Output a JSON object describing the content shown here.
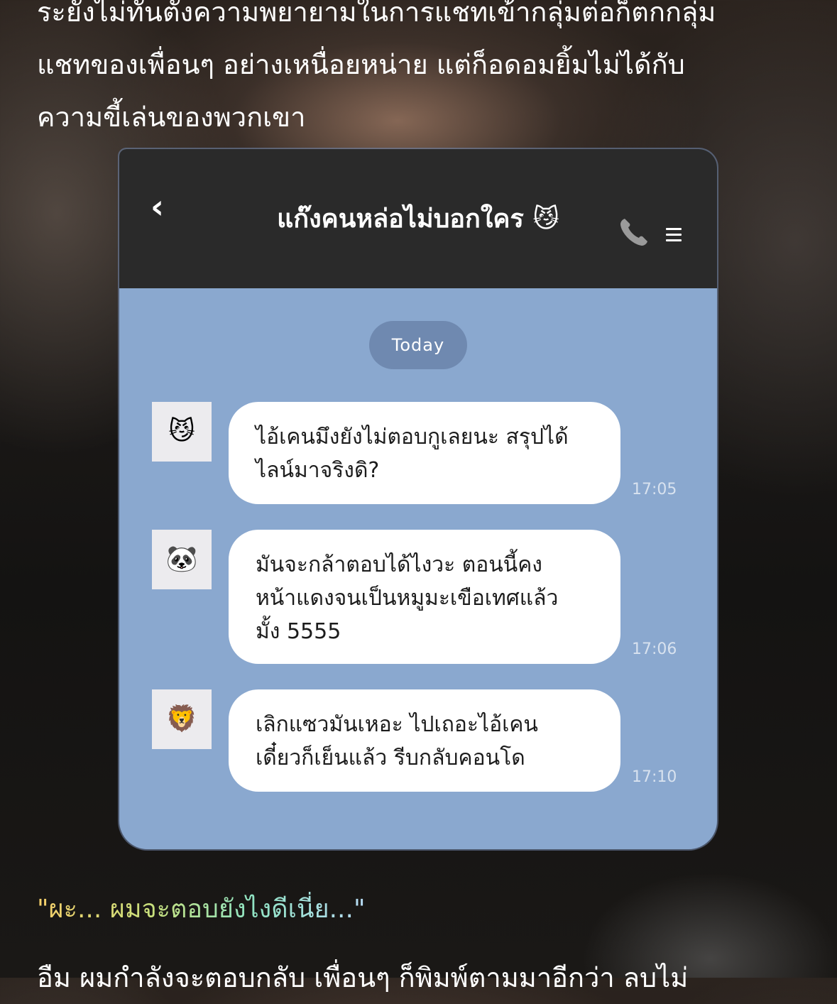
{
  "narration": {
    "top_lines": [
      "ระยังไม่ทันตั้งความพยายามในการแชทเข้ากลุ่มต่อก็ตกกลุ่ม",
      "แชทของเพื่อนๆ อย่างเหนื่อยหน่าย แต่ก็อดอมยิ้มไม่ได้กับ",
      "ความขี้เล่นของพวกเขา"
    ],
    "bottom_line": "อืม ผมกำลังจะตอบกลับ เพื่อนๆ ก็พิมพ์ตามมาอีกว่า ลบไม่"
  },
  "chat": {
    "back_icon": "‹",
    "title": "แก๊งคนหล่อไม่บอกใคร 😼",
    "date_label": "Today",
    "icons": {
      "back": "chevron-left-icon",
      "call": "phone-icon",
      "menu": "hamburger-menu-icon"
    },
    "colors": {
      "header_bg": "#2a2a2a",
      "chat_bg": "#8aa8cf",
      "date_pill_bg": "#6f89b0",
      "bubble_bg": "#ffffff"
    },
    "messages": [
      {
        "avatar": "😼",
        "lines": [
          "ไอ้เคนมึงยังไม่ตอบกูเลยนะ สรุปได้",
          "ไลน์มาจริงดิ?"
        ],
        "time": "17:05"
      },
      {
        "avatar": "🐼",
        "lines": [
          "มันจะกล้าตอบได้ไงวะ ตอนนี้คง",
          "หน้าแดงจนเป็นหมูมะเขือเทศแล้ว",
          "มั้ง 5555"
        ],
        "time": "17:06"
      },
      {
        "avatar": "🦁",
        "lines": [
          "เลิกแซวมันเหอะ ไปเถอะไอ้เคน",
          "เดี๋ยวก็เย็นแล้ว รีบกลับคอนโด"
        ],
        "time": "17:10"
      }
    ]
  },
  "quote": "\"ผะ... ผมจะตอบยังไงดีเนี่ย...\""
}
